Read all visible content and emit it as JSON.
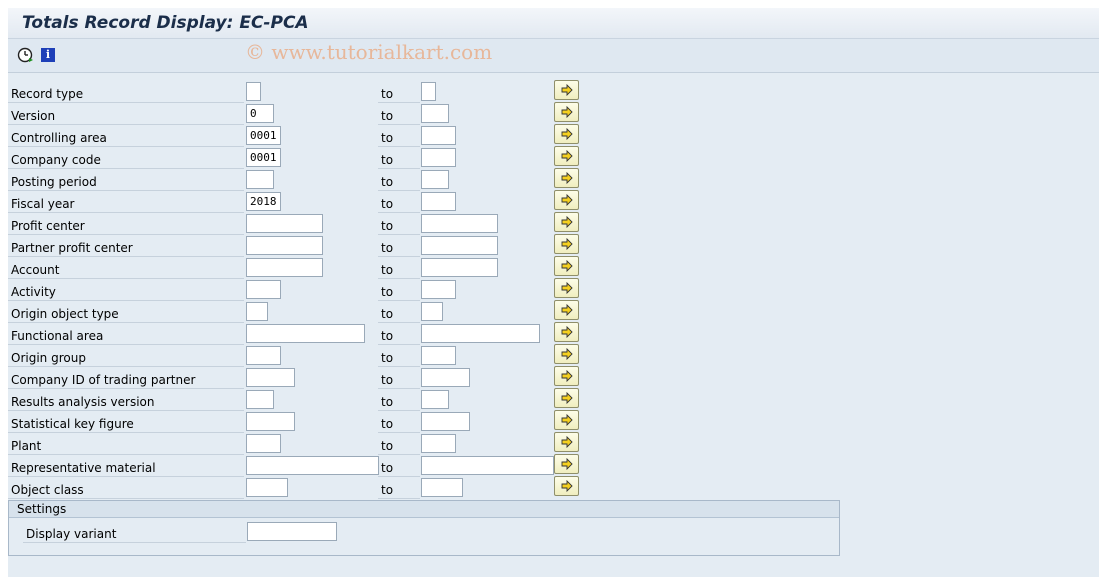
{
  "title": "Totals Record Display: EC-PCA",
  "watermark": "© www.tutorialkart.com",
  "toolbar": {
    "execute_icon": "execute-clock-icon",
    "info_icon": "info-icon",
    "info_glyph": "i"
  },
  "range_to_label": "to",
  "fields": [
    {
      "label": "Record type",
      "low": "",
      "high": ""
    },
    {
      "label": "Version",
      "low": "0",
      "high": ""
    },
    {
      "label": "Controlling area",
      "low": "0001",
      "high": ""
    },
    {
      "label": "Company code",
      "low": "0001",
      "high": ""
    },
    {
      "label": "Posting period",
      "low": "",
      "high": ""
    },
    {
      "label": "Fiscal year",
      "low": "2018",
      "high": ""
    },
    {
      "label": "Profit center",
      "low": "",
      "high": ""
    },
    {
      "label": "Partner profit center",
      "low": "",
      "high": ""
    },
    {
      "label": "Account",
      "low": "",
      "high": ""
    },
    {
      "label": "Activity",
      "low": "",
      "high": ""
    },
    {
      "label": "Origin object type",
      "low": "",
      "high": ""
    },
    {
      "label": "Functional area",
      "low": "",
      "high": ""
    },
    {
      "label": "Origin group",
      "low": "",
      "high": ""
    },
    {
      "label": "Company ID of trading partner",
      "low": "",
      "high": ""
    },
    {
      "label": "Results analysis version",
      "low": "",
      "high": ""
    },
    {
      "label": "Statistical key figure",
      "low": "",
      "high": ""
    },
    {
      "label": "Plant",
      "low": "",
      "high": ""
    },
    {
      "label": "Representative material",
      "low": "",
      "high": ""
    },
    {
      "label": "Object class",
      "low": "",
      "high": ""
    }
  ],
  "settings": {
    "title": "Settings",
    "display_variant_label": "Display variant",
    "display_variant_value": ""
  },
  "colors": {
    "title_text": "#1b2e4a",
    "toolbar_bg": "#dfe8f1",
    "content_bg": "#e4ecf3",
    "selection_button": "#f0eebf",
    "watermark": "#e7b79a"
  }
}
